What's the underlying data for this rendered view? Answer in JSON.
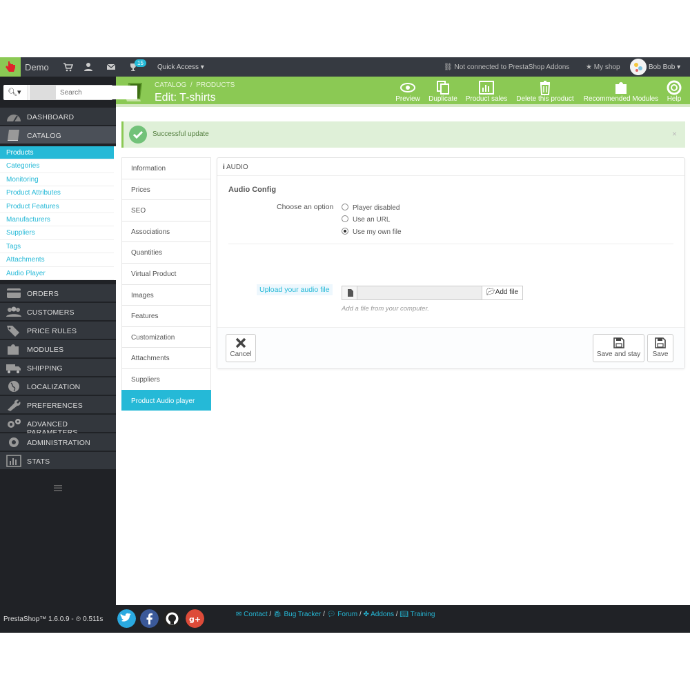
{
  "topbar": {
    "shop_name": "Demo",
    "badge_count": "15",
    "quick_access": "Quick Access",
    "addons_status": "Not connected to PrestaShop Addons",
    "my_shop": "My shop",
    "user_name": "Bob Bob"
  },
  "header": {
    "breadcrumb_1": "CATALOG",
    "breadcrumb_sep": "/",
    "breadcrumb_2": "PRODUCTS",
    "title": "Edit: T-shirts",
    "toolbar": {
      "preview": "Preview",
      "duplicate": "Duplicate",
      "product_sales": "Product sales",
      "delete": "Delete this product",
      "recommended": "Recommended Modules",
      "help": "Help"
    }
  },
  "search": {
    "placeholder": "Search"
  },
  "menu": {
    "dashboard": "DASHBOARD",
    "catalog": "CATALOG",
    "orders": "ORDERS",
    "customers": "CUSTOMERS",
    "price_rules": "PRICE RULES",
    "modules": "MODULES",
    "shipping": "SHIPPING",
    "localization": "LOCALIZATION",
    "preferences": "PREFERENCES",
    "advanced": "ADVANCED PARAMETERS",
    "administration": "ADMINISTRATION",
    "stats": "STATS"
  },
  "submenu": [
    "Products",
    "Categories",
    "Monitoring",
    "Product Attributes",
    "Product Features",
    "Manufacturers",
    "Suppliers",
    "Tags",
    "Attachments",
    "Audio Player"
  ],
  "alert": {
    "text": "Successful update",
    "close": "×"
  },
  "tabs": [
    "Information",
    "Prices",
    "SEO",
    "Associations",
    "Quantities",
    "Virtual Product",
    "Images",
    "Features",
    "Customization",
    "Attachments",
    "Suppliers",
    "Product Audio player"
  ],
  "panel": {
    "heading": "AUDIO",
    "section_title": "Audio Config",
    "option_label": "Choose an option",
    "options": [
      "Player disabled",
      "Use an URL",
      "Use my own file"
    ],
    "selected_option": "Use my own file",
    "upload_label": "Upload your audio file",
    "add_file": "Add file",
    "hint": "Add a file from your computer.",
    "cancel": "Cancel",
    "save_and_stay": "Save and stay",
    "save": "Save"
  },
  "footer": {
    "version": "PrestaShop™ 1.6.0.9 - ",
    "load_time": "0.511s",
    "links": [
      "Contact",
      "Bug Tracker",
      "Forum",
      "Addons",
      "Training"
    ]
  },
  "colors": {
    "accent_green": "#8bc954",
    "link_blue": "#25b9d7",
    "dark_bg": "#202226",
    "topbar_bg": "#363a41"
  }
}
